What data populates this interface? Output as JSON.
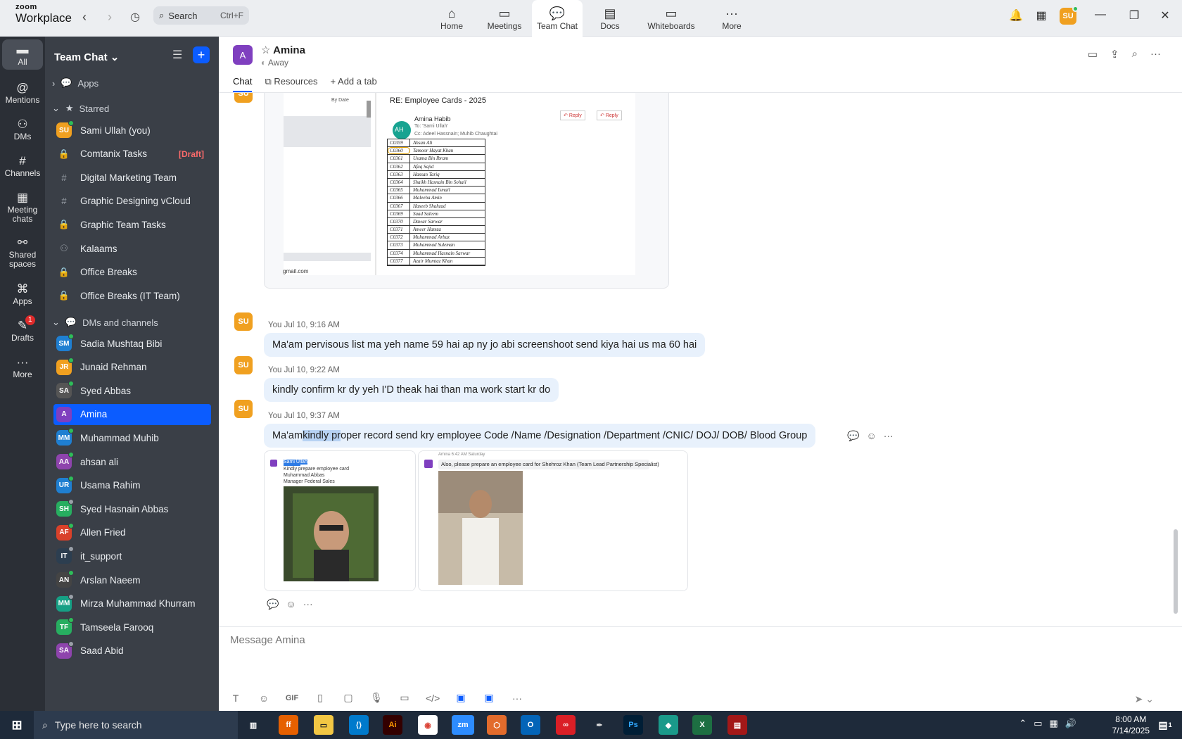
{
  "app": {
    "logo_top": "zoom",
    "logo_bottom": "Workplace",
    "search_placeholder": "Search",
    "search_shortcut": "Ctrl+F",
    "nav_tabs": [
      {
        "label": "Home",
        "icon": "home-icon"
      },
      {
        "label": "Meetings",
        "icon": "video-icon"
      },
      {
        "label": "Team Chat",
        "icon": "chat-icon",
        "active": true
      },
      {
        "label": "Docs",
        "icon": "doc-icon"
      },
      {
        "label": "Whiteboards",
        "icon": "whiteboard-icon"
      },
      {
        "label": "More",
        "icon": "more-icon"
      }
    ],
    "user_initials": "SU"
  },
  "rail": [
    {
      "label": "All",
      "icon": "chat-bubble-icon",
      "active": true
    },
    {
      "label": "Mentions",
      "icon": "at-icon"
    },
    {
      "label": "DMs",
      "icon": "people-icon"
    },
    {
      "label": "Channels",
      "icon": "hash-icon"
    },
    {
      "label": "Meeting chats",
      "icon": "calendar-icon"
    },
    {
      "label": "Shared spaces",
      "icon": "shared-spaces-icon"
    },
    {
      "label": "Apps",
      "icon": "apps-icon"
    },
    {
      "label": "Drafts",
      "icon": "drafts-icon",
      "badge": "1"
    },
    {
      "label": "More",
      "icon": "more-icon"
    }
  ],
  "sidebar": {
    "title": "Team Chat",
    "sections": {
      "apps": "Apps",
      "starred": "Starred",
      "dms": "DMs and channels"
    },
    "starred": [
      {
        "name": "Sami Ullah (you)",
        "initials": "SU",
        "color": "#f0a020",
        "status": "#2ebd59"
      },
      {
        "name": "Comtanix Tasks",
        "type": "lock",
        "draft": "[Draft]"
      },
      {
        "name": "Digital Marketing Team",
        "type": "hash"
      },
      {
        "name": "Graphic Designing vCloud",
        "type": "hash"
      },
      {
        "name": "Graphic Team Tasks",
        "type": "lock"
      },
      {
        "name": "Kalaams",
        "type": "group"
      },
      {
        "name": "Office Breaks",
        "type": "lock"
      },
      {
        "name": "Office Breaks (IT Team)",
        "type": "lock"
      }
    ],
    "dms": [
      {
        "name": "Sadia Mushtaq Bibi",
        "initials": "SM",
        "color": "#1f7fd1",
        "status": "#2ebd59"
      },
      {
        "name": "Junaid Rehman",
        "initials": "JR",
        "color": "#f0a020",
        "status": "#2ebd59"
      },
      {
        "name": "Syed Abbas",
        "initials": "SA",
        "color": "#555555",
        "status": "#2ebd59"
      },
      {
        "name": "Amina",
        "initials": "A",
        "color": "#7f3fbf",
        "selected": true
      },
      {
        "name": "Muhammad Muhib",
        "initials": "MM",
        "color": "#1f7fd1",
        "status": "#2ebd59"
      },
      {
        "name": "ahsan ali",
        "initials": "AA",
        "color": "#8e44ad",
        "status": "#2ebd59"
      },
      {
        "name": "Usama Rahim",
        "initials": "UR",
        "color": "#1f7fd1",
        "status": "#2ebd59"
      },
      {
        "name": "Syed Hasnain Abbas",
        "initials": "SH",
        "color": "#27ae60",
        "status": "#9aa0a8"
      },
      {
        "name": "Allen Fried",
        "initials": "AF",
        "color": "#d9412a",
        "status": "#2ebd59"
      },
      {
        "name": "it_support",
        "initials": "IT",
        "color": "#2c3e50",
        "status": "#9aa0a8"
      },
      {
        "name": "Arslan Naeem",
        "initials": "AN",
        "color": "#444444",
        "status": "#2ebd59"
      },
      {
        "name": "Mirza Muhammad Khurram",
        "initials": "MM",
        "color": "#16a085",
        "status": "#9aa0a8"
      },
      {
        "name": "Tamseela Farooq",
        "initials": "TF",
        "color": "#27ae60",
        "status": "#2ebd59"
      },
      {
        "name": "Saad Abid",
        "initials": "SA",
        "color": "#8e44ad",
        "status": "#9aa0a8"
      }
    ]
  },
  "chat_header": {
    "initials": "A",
    "name": "Amina",
    "status": "Away",
    "tabs": [
      "Chat",
      "Resources",
      "Add a tab"
    ]
  },
  "messages": [
    {
      "sender": "SU",
      "meta": "You Jul 10, 9:16 AM",
      "text": "Ma'am pervisous list ma yeh name 59 hai ap ny jo abi screenshoot send kiya hai us ma 60 hai"
    },
    {
      "sender": "SU",
      "meta": "You Jul 10, 9:22 AM",
      "text": "kindly confirm kr dy yeh I'D theak hai than ma work start kr do"
    },
    {
      "sender": "SU",
      "meta": "You Jul 10, 9:37 AM",
      "text_before": "Ma'am ",
      "text_highlight": "kindly pr",
      "text_after": "oper record send kry employee Code /Name /Designation /Department /CNIC/ DOJ/ DOB/ Blood Group"
    }
  ],
  "email_preview": {
    "subject": "RE: Employee Cards - 2025",
    "from": "Amina Habib",
    "from_initials": "AH",
    "to": "To: 'Sami Ullah'",
    "cc": "Cc: Adeel Hassnain; Muhib Chaughtai",
    "reply": "Reply",
    "sort": "By Date",
    "email_snip": "gmail.com",
    "rows": [
      [
        "C0359",
        "Ahsan Ali"
      ],
      [
        "C0360",
        "Tamoor Hayat Khan"
      ],
      [
        "C0361",
        "Usama Bin Ibram"
      ],
      [
        "C0362",
        "Afaq Sajid"
      ],
      [
        "C0363",
        "Hassan Tariq"
      ],
      [
        "C0364",
        "Shaikh Hasnain Bin Sohail"
      ],
      [
        "C0365",
        "Muhammad Ismail"
      ],
      [
        "C0366",
        "Maleeha Amin"
      ],
      [
        "C0367",
        "Haseeb Shahzad"
      ],
      [
        "C0369",
        "Saad Saleem"
      ],
      [
        "C0370",
        "Dawar Sarwar"
      ],
      [
        "C0371",
        "Ameer Hamza"
      ],
      [
        "C0372",
        "Muhammad Arbaz"
      ],
      [
        "C0373",
        "Muhammad Suleman"
      ],
      [
        "C0374",
        "Muhammad Hasnain Sarwar"
      ],
      [
        "C0377",
        "Azair Mumtaz Khan"
      ]
    ]
  },
  "attachment_preview": {
    "left_lines": [
      "Sami Ullah",
      "Kindly prepare employee card",
      "Muhammad Abbas",
      "Manager Federal Sales"
    ],
    "right_header": "Amina 6:42 AM Saturday",
    "right_text": "Also, please prepare an employee card for Shehroz Khan (Team Lead Partnership Specialist)"
  },
  "composer": {
    "placeholder": "Message Amina"
  },
  "taskbar": {
    "search_placeholder": "Type here to search",
    "time": "8:00 AM",
    "date": "7/14/2025",
    "notif_count": "1"
  }
}
